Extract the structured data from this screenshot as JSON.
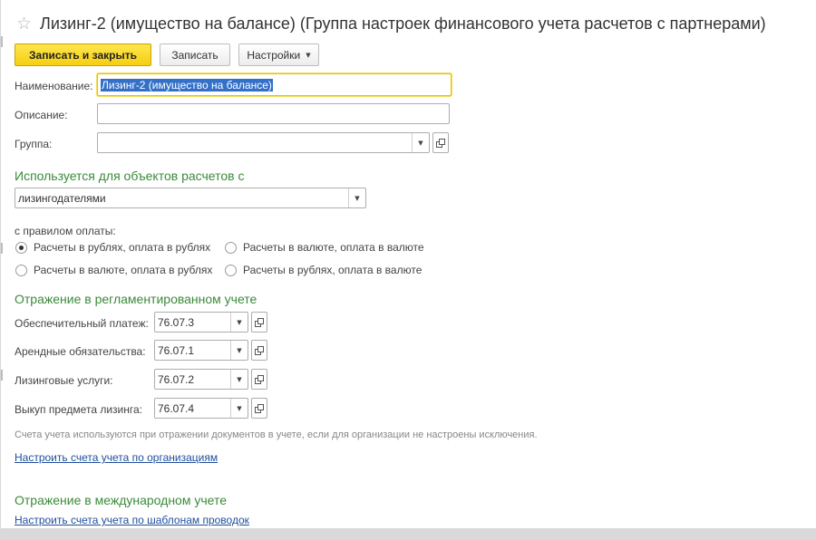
{
  "window": {
    "title": "Лизинг-2 (имущество на балансе) (Группа настроек финансового учета расчетов с партнерами)"
  },
  "toolbar": {
    "save_close_label": "Записать и закрыть",
    "save_label": "Записать",
    "settings_label": "Настройки"
  },
  "form": {
    "name_label": "Наименование:",
    "name_value": "Лизинг-2 (имущество на балансе)",
    "description_label": "Описание:",
    "description_value": "",
    "group_label": "Группа:",
    "group_value": ""
  },
  "settlement": {
    "heading": "Используется для объектов расчетов с",
    "counterparty_value": "лизингодателями",
    "payment_rule_label": "с правилом оплаты:",
    "options": [
      {
        "label": "Расчеты в рублях, оплата в рублях",
        "selected": true
      },
      {
        "label": "Расчеты в валюте, оплата в валюте",
        "selected": false
      },
      {
        "label": "Расчеты в валюте, оплата в рублях",
        "selected": false
      },
      {
        "label": "Расчеты в рублях, оплата в валюте",
        "selected": false
      }
    ]
  },
  "regulated": {
    "heading": "Отражение в регламентированном учете",
    "accounts": [
      {
        "label": "Обеспечительный платеж:",
        "value": "76.07.3"
      },
      {
        "label": "Арендные обязательства:",
        "value": "76.07.1"
      },
      {
        "label": "Лизинговые услуги:",
        "value": "76.07.2"
      },
      {
        "label": "Выкуп предмета лизинга:",
        "value": "76.07.4"
      }
    ],
    "hint": "Счета учета используются при отражении документов в учете, если для организации не настроены исключения.",
    "link": "Настроить счета учета по организациям"
  },
  "international": {
    "heading": "Отражение в международном учете",
    "link": "Настроить счета учета по шаблонам проводок"
  },
  "icons": {
    "star": "star-icon",
    "dropdown": "triangle-down-icon",
    "open": "open-window-icon"
  },
  "colors": {
    "primary_button": "#f6cf12",
    "section_heading": "#3a8a3a",
    "link": "#1f4e9c",
    "selection": "#3370c8",
    "focus_border": "#e6c200"
  }
}
